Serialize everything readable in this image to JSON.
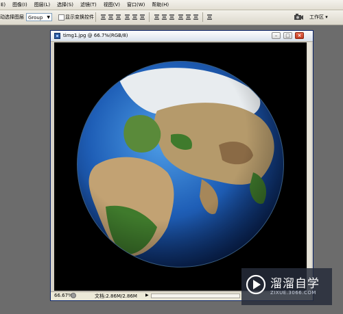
{
  "menubar": {
    "items": [
      "E)",
      "图像(I)",
      "图层(L)",
      "选择(S)",
      "滤镜(T)",
      "视图(V)",
      "窗口(W)",
      "帮助(H)"
    ]
  },
  "options": {
    "auto_select_label": "动选择图层",
    "group_value": "Group",
    "show_transform_label": "显示变换控件",
    "workspace_label": "工作区 ▾"
  },
  "document": {
    "title": "timg1.jpg @ 66.7%(RGB/8)",
    "zoom": "66.67%",
    "doc_info": "文档:2.86M/2.86M",
    "status_arrow": "▶"
  },
  "window_buttons": {
    "minimize": "–",
    "maximize": "□",
    "close": "×"
  },
  "watermark": {
    "name": "溜溜自学",
    "url": "ZIXUE.3066.COM"
  },
  "colors": {
    "workspace_bg": "#6c6c6c",
    "ocean": "#1f5fb7",
    "land_desert": "#b59a6b",
    "land_green": "#3f7a2c",
    "ice": "#e8ecef"
  },
  "icons": [
    "doc-icon",
    "dropdown-arrow-icon",
    "align-icon",
    "workspace-camera-icon",
    "zoom-icon",
    "watermark-play-logo"
  ]
}
